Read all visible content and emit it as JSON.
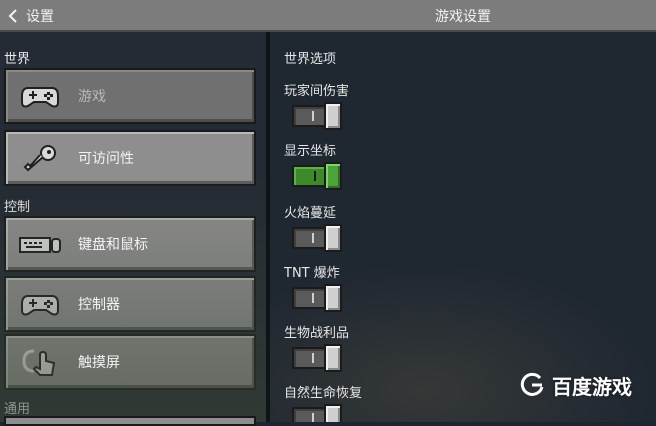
{
  "header": {
    "back_label": "设置",
    "title": "游戏设置"
  },
  "sidebar": {
    "sections": [
      {
        "label": "世界"
      },
      {
        "label": "控制"
      },
      {
        "label": "通用"
      }
    ],
    "items": [
      {
        "label": "游戏",
        "icon": "gamepad-icon",
        "selected": true
      },
      {
        "label": "可访问性",
        "icon": "key-icon",
        "selected": false
      },
      {
        "label": "键盘和鼠标",
        "icon": "keyboard-mouse-icon",
        "selected": false
      },
      {
        "label": "控制器",
        "icon": "controller-icon",
        "selected": false
      },
      {
        "label": "触摸屏",
        "icon": "touch-icon",
        "selected": false
      }
    ]
  },
  "main": {
    "section_title": "世界选项",
    "options": [
      {
        "label": "玩家间伤害",
        "enabled": false
      },
      {
        "label": "显示坐标",
        "enabled": true
      },
      {
        "label": "火焰蔓延",
        "enabled": false
      },
      {
        "label": "TNT 爆炸",
        "enabled": false
      },
      {
        "label": "生物战利品",
        "enabled": false
      },
      {
        "label": "自然生命恢复",
        "enabled": false
      }
    ]
  },
  "watermark": {
    "text": "百度游戏",
    "icon": "baidu-games-logo-icon"
  },
  "colors": {
    "toggle_on": "#4ba33a",
    "toggle_off": "#cfcfcf",
    "button_bg": "#8e8e8e",
    "button_selected_bg": "#707070"
  }
}
